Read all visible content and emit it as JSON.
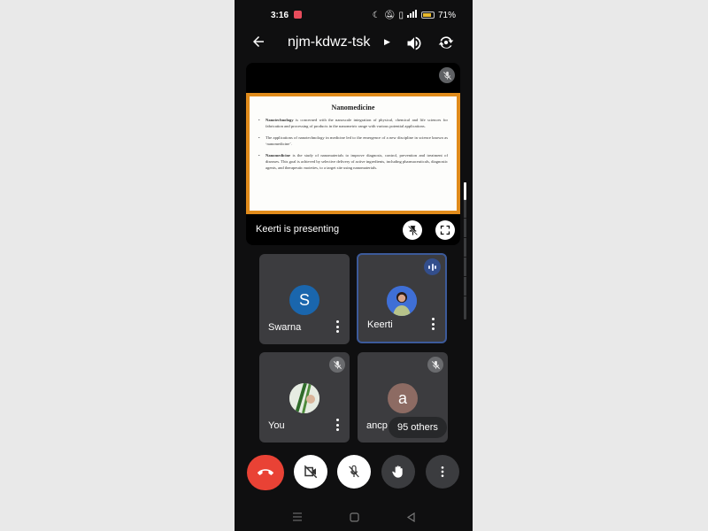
{
  "status_bar": {
    "time": "3:16",
    "battery_percent": "71%",
    "battery_level": 0.71,
    "icons": [
      "moon-icon",
      "dnd-icon",
      "vibrate-icon",
      "signal-icon",
      "battery-icon"
    ]
  },
  "topbar": {
    "back_icon": "arrow-left-icon",
    "meeting_code": "njm-kdwz-tsk",
    "caret_icon": "caret-right-icon",
    "speaker_icon": "speaker-icon",
    "switch_camera_icon": "switch-camera-icon"
  },
  "presentation": {
    "muted_icon": "mic-off-icon",
    "slide": {
      "title": "Nanomedicine",
      "bullets": [
        {
          "bold": "Nanotechnology",
          "text": " is concerned with the nanoscale integration of physical, chemical and life sciences for fabrication and processing of products in the nanometric range with various potential applications."
        },
        {
          "bold": "",
          "text": "The applications of nanotechnology in medicine led to the emergence of a new discipline in science known as ‘nanomedicine’."
        },
        {
          "bold": "Nanomedicine",
          "text": " is the study of nanomaterials to improve diagnosis, control, prevention and treatment of diseases. This goal is achieved by selective delivery of active ingredients, including pharmaceuticals, diagnostic agents, and therapeutic moieties, to a target site using nanomaterials."
        }
      ]
    },
    "presenting_label": "Keerti is presenting",
    "unpin_icon": "unpin-icon",
    "fullscreen_icon": "fullscreen-icon"
  },
  "participants": [
    {
      "name": "Swarna",
      "avatar_letter": "S",
      "avatar_color": "#1a66ad",
      "muted": false,
      "speaking": false
    },
    {
      "name": "Keerti",
      "avatar_letter": "",
      "avatar_color": "#3f6fd6",
      "muted": false,
      "speaking": true
    },
    {
      "name": "You",
      "avatar_letter": "",
      "avatar_color": "#5d7b4a",
      "muted": true,
      "speaking": false
    },
    {
      "name": "ancp",
      "avatar_letter": "a",
      "avatar_color": "#8d6b63",
      "muted": true,
      "speaking": false
    }
  ],
  "others_label": "95 others",
  "controls": {
    "end_call": "end-call",
    "camera": "camera-off",
    "mic": "mic-off",
    "raise_hand": "raise-hand",
    "more": "more-options"
  },
  "colors": {
    "end_call": "#e94235",
    "slide_border": "#e08b1b",
    "active_tile_border": "#3c5a9a"
  }
}
